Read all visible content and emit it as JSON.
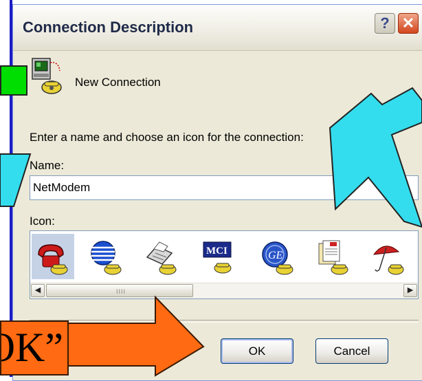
{
  "window": {
    "title": "Connection Description",
    "help_glyph": "?",
    "close_glyph": "✕"
  },
  "connection": {
    "name_display": "New Connection",
    "icon": "phone-modem-icon"
  },
  "form": {
    "prompt": "Enter a name and choose an icon for the connection:",
    "name_label": "Name:",
    "name_value": "NetModem",
    "icon_label": "Icon:"
  },
  "icon_choices": [
    {
      "name": "red-phone-icon",
      "selected": true
    },
    {
      "name": "globe-phone-icon",
      "selected": false
    },
    {
      "name": "fax-phone-icon",
      "selected": false
    },
    {
      "name": "mci-phone-icon",
      "selected": false
    },
    {
      "name": "ge-phone-icon",
      "selected": false
    },
    {
      "name": "documents-phone-icon",
      "selected": false
    },
    {
      "name": "umbrella-phone-icon",
      "selected": false
    }
  ],
  "scrollbar": {
    "left_glyph": "◀",
    "right_glyph": "▶",
    "grip": "IIII"
  },
  "buttons": {
    "ok": "OK",
    "cancel": "Cancel"
  },
  "annotations": {
    "ok_callout": "OK”",
    "arrow_color": "#33ddee",
    "callout_color": "#ff6a12",
    "box_color": "#00dd00"
  }
}
